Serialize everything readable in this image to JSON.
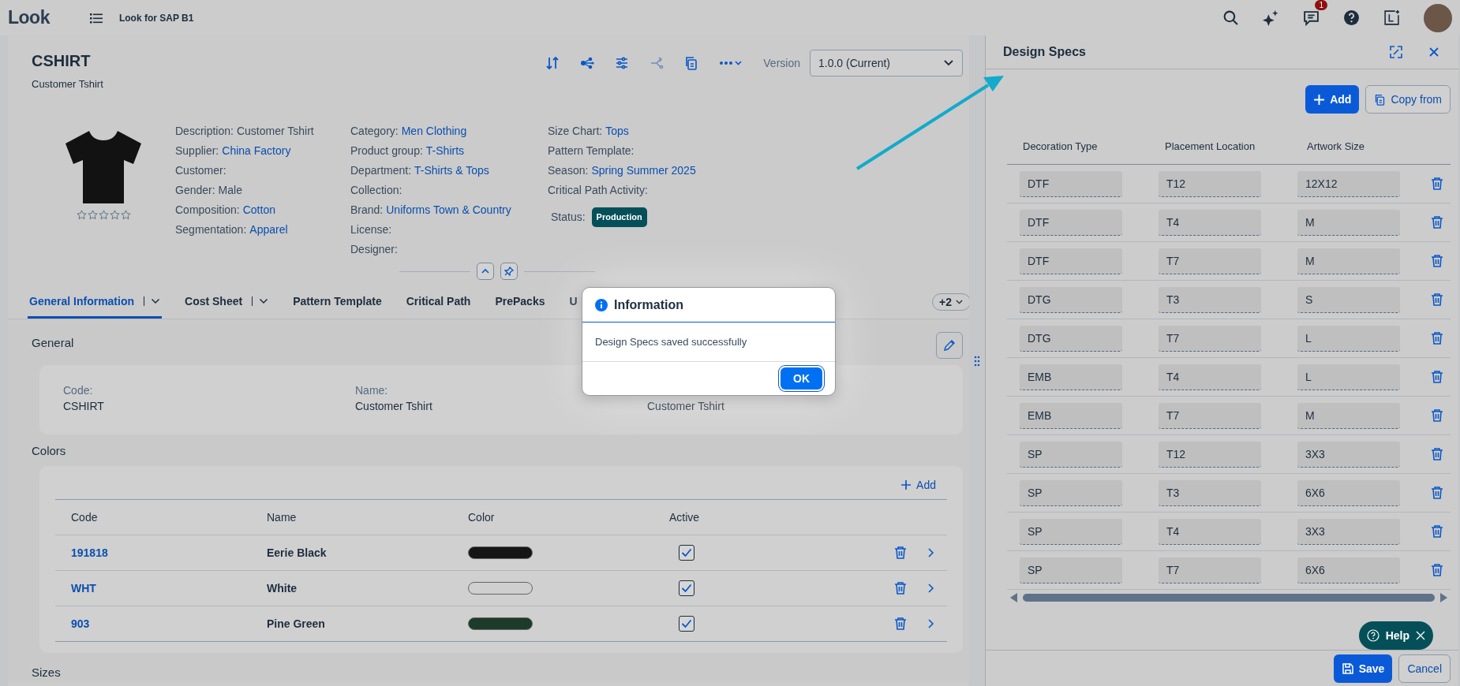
{
  "top_bar": {
    "logo": "Look",
    "app_title": "Look for SAP B1",
    "notification_count": "1"
  },
  "product": {
    "code": "CSHIRT",
    "name": "Customer Tshirt",
    "version_label": "Version",
    "version_value": "1.0.0 (Current)",
    "stars": 0,
    "detail_columns": [
      [
        {
          "label": "Description:",
          "value": "Customer Tshirt",
          "link": false
        },
        {
          "label": "Supplier:",
          "value": "China Factory",
          "link": true
        },
        {
          "label": "Customer:"
        },
        {
          "label": "Gender:",
          "value": "Male",
          "link": false
        },
        {
          "label": "Composition:",
          "value": "Cotton",
          "link": true
        },
        {
          "label": "Segmentation:",
          "value": "Apparel",
          "link": true
        }
      ],
      [
        {
          "label": "Category:",
          "value": "Men Clothing",
          "link": true
        },
        {
          "label": "Product group:",
          "value": "T-Shirts",
          "link": true
        },
        {
          "label": "Department:",
          "value": "T-Shirts & Tops",
          "link": true
        },
        {
          "label": "Collection:"
        },
        {
          "label": "Brand:",
          "value": "Uniforms Town & Country",
          "link": true
        },
        {
          "label": "License:"
        },
        {
          "label": "Designer:"
        }
      ],
      [
        {
          "label": "Size Chart:",
          "value": "Tops",
          "link": true
        },
        {
          "label": "Pattern Template:"
        },
        {
          "label": "Season:",
          "value": "Spring Summer 2025",
          "link": true
        },
        {
          "label": "Critical Path Activity:"
        }
      ]
    ],
    "status": {
      "label": "Status:",
      "value": "Production"
    }
  },
  "tabs": [
    {
      "label": "General Information",
      "selected": true,
      "has_menu": true
    },
    {
      "label": "Cost Sheet",
      "selected": false,
      "has_menu": true
    },
    {
      "label": "Pattern Template",
      "selected": false,
      "has_menu": false
    },
    {
      "label": "Critical Path",
      "selected": false,
      "has_menu": false
    },
    {
      "label": "PrePacks",
      "selected": false,
      "has_menu": false
    },
    {
      "label": "U",
      "selected": false,
      "has_menu": false
    }
  ],
  "more_tabs": "+2",
  "general": {
    "title": "General",
    "fields": [
      {
        "label": "Code:",
        "value": "CSHIRT"
      },
      {
        "label": "Name:",
        "value": "Customer Tshirt"
      },
      {
        "value": "Customer Tshirt"
      }
    ]
  },
  "colors": {
    "title": "Colors",
    "add": "Add",
    "columns": [
      "Code",
      "Name",
      "Color",
      "Active"
    ],
    "rows": [
      {
        "code": "191818",
        "name": "Eerie Black",
        "color": "#161616",
        "active": true
      },
      {
        "code": "WHT",
        "name": "White",
        "color": "#cfcfcf",
        "active": true
      },
      {
        "code": "903",
        "name": "Pine Green",
        "color": "#1d3b2a",
        "active": true
      }
    ]
  },
  "next_section": "Sizes",
  "dialog": {
    "title": "Information",
    "message": "Design Specs saved successfully",
    "button": "OK"
  },
  "design_specs": {
    "title": "Design Specs",
    "add": "Add",
    "copy": "Copy from",
    "columns": [
      "Decoration Type",
      "Placement Location",
      "Artwork Size"
    ],
    "rows": [
      {
        "decoration": "DTF",
        "placement": "T12",
        "size": "12X12"
      },
      {
        "decoration": "DTF",
        "placement": "T4",
        "size": "M"
      },
      {
        "decoration": "DTF",
        "placement": "T7",
        "size": "M"
      },
      {
        "decoration": "DTG",
        "placement": "T3",
        "size": "S"
      },
      {
        "decoration": "DTG",
        "placement": "T7",
        "size": "L"
      },
      {
        "decoration": "EMB",
        "placement": "T4",
        "size": "L"
      },
      {
        "decoration": "EMB",
        "placement": "T7",
        "size": "M"
      },
      {
        "decoration": "SP",
        "placement": "T12",
        "size": "3X3"
      },
      {
        "decoration": "SP",
        "placement": "T3",
        "size": "6X6"
      },
      {
        "decoration": "SP",
        "placement": "T4",
        "size": "3X3"
      },
      {
        "decoration": "SP",
        "placement": "T7",
        "size": "6X6"
      }
    ],
    "help": "Help",
    "save": "Save",
    "cancel": "Cancel"
  }
}
